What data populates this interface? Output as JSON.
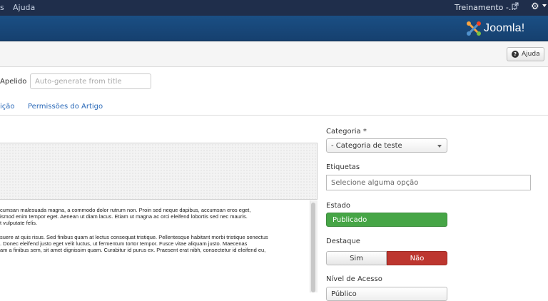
{
  "topbar": {
    "menu_items": [
      "s",
      "Ajuda"
    ],
    "site_name": "Treinamento -...",
    "site_link_icon": "external-link-icon",
    "settings_icon": "gear-icon"
  },
  "brand": {
    "logo_text": "Joomla!",
    "logo_icon": "joomla-logo-icon"
  },
  "toolbar": {
    "help_label": "Ajuda",
    "help_icon": "question-icon"
  },
  "alias": {
    "label": "Apelido",
    "placeholder": "Auto-generate from title"
  },
  "tabs": [
    "ição",
    "Permissões do Artigo"
  ],
  "editor": {
    "paragraphs": [
      [
        "cumsan malesuada magna, a commodo dolor rutrum non. Proin sed neque dapibus, accumsan eros eget,",
        "ismod enim tempor eget. Aenean ut diam lacus. Etiam ut magna ac orci eleifend lobortis sed nec mauris.",
        "t vulputate felis."
      ],
      [
        "suere at quis risus. Sed finibus quam at lectus consequat tristique. Pellentesque habitant morbi tristique senectus",
        ". Donec eleifend justo eget velit luctus, ut fermentum tortor tempor. Fusce vitae aliquam justo. Maecenas",
        "am a finibus sem, sit amet dignissim quam. Curabitur id purus ex. Praesent erat nibh, consectetur id eleifend eu,"
      ]
    ]
  },
  "sidebar": {
    "category": {
      "label": "Categoria *",
      "value": "- Categoria de teste"
    },
    "tags": {
      "label": "Etiquetas",
      "placeholder": "Selecione alguma opção"
    },
    "state": {
      "label": "Estado",
      "value": "Publicado",
      "color": "#46a546"
    },
    "featured": {
      "label": "Destaque",
      "options": [
        "Sim",
        "Não"
      ],
      "selected": "Não",
      "selected_color": "#bd362f"
    },
    "access": {
      "label": "Nível de Acesso",
      "value": "Público"
    }
  }
}
